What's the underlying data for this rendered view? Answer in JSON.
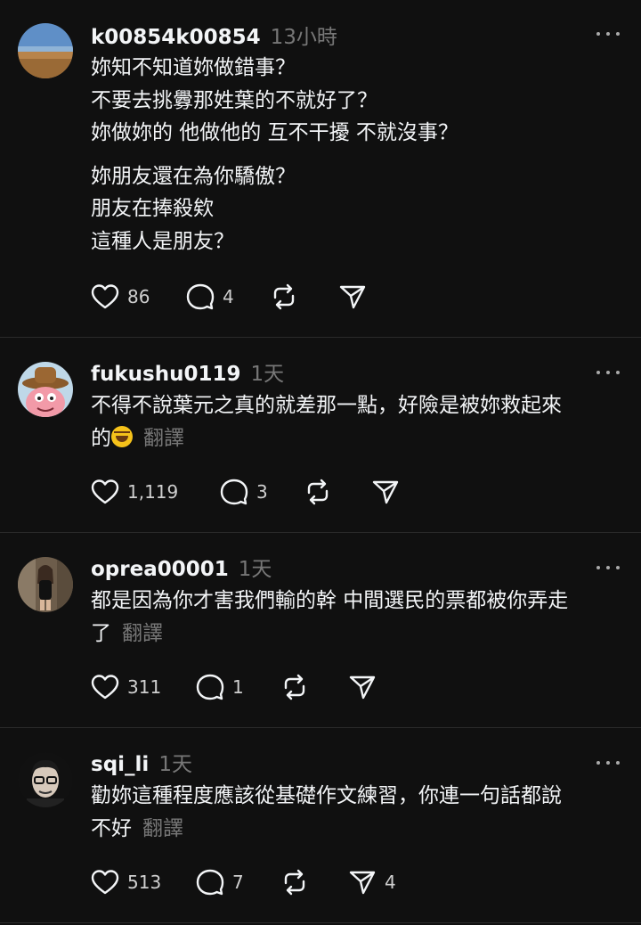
{
  "posts": [
    {
      "username": "k00854k00854",
      "time": "13小時",
      "body": [
        "妳知不知道妳做錯事？",
        "不要去挑釁那姓葉的不就好了？",
        "妳做妳的 他做他的 互不干擾 不就沒事？",
        "妳朋友還在為你驕傲？",
        "朋友在捧殺欸",
        "這種人是朋友？"
      ],
      "like_count": "86",
      "reply_count": "4",
      "share_count": ""
    },
    {
      "username": "fukushu0119",
      "time": "1天",
      "body": [
        "不得不說葉元之真的就差那一點，好險是被妳救起來",
        "的"
      ],
      "translate": "翻譯",
      "like_count": "1,119",
      "reply_count": "3",
      "share_count": ""
    },
    {
      "username": "oprea00001",
      "time": "1天",
      "body": [
        "都是因為你才害我們輸的幹 中間選民的票都被你弄走",
        "了"
      ],
      "translate": "翻譯",
      "like_count": "311",
      "reply_count": "1",
      "share_count": ""
    },
    {
      "username": "sqi_li",
      "time": "1天",
      "body": [
        "勸妳這種程度應該從基礎作文練習，你連一句話都說",
        "不好"
      ],
      "translate": "翻譯",
      "like_count": "513",
      "reply_count": "7",
      "share_count": "4"
    }
  ],
  "colors": {
    "background": "#101010",
    "text": "#f3f5f7",
    "muted": "#777777",
    "divider": "#2a2a2a"
  },
  "icons": [
    "heart-icon",
    "comment-icon",
    "repost-icon",
    "send-icon",
    "more-icon"
  ]
}
